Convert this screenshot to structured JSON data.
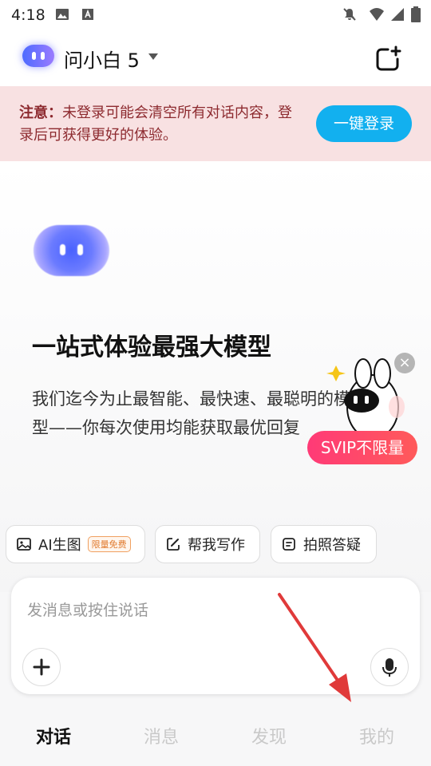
{
  "status_bar": {
    "time": "4:18"
  },
  "header": {
    "title": "问小白 5"
  },
  "notice": {
    "prefix": "注意：",
    "text": "未登录可能会清空所有对话内容，登录后可获得更好的体验。",
    "login_button": "一键登录"
  },
  "hero": {
    "headline": "一站式体验最强大模型",
    "description": "我们迄今为止最智能、最快速、最聪明的模型——你每次使用均能获取最优回复"
  },
  "promo": {
    "badge": "SVIP不限量"
  },
  "chips": [
    {
      "label": "AI生图",
      "tag": "限量免费"
    },
    {
      "label": "帮我写作"
    },
    {
      "label": "拍照答疑"
    }
  ],
  "input": {
    "placeholder": "发消息或按住说话"
  },
  "tabs": [
    {
      "label": "对话",
      "active": true
    },
    {
      "label": "消息",
      "active": false
    },
    {
      "label": "发现",
      "active": false
    },
    {
      "label": "我的",
      "active": false
    }
  ],
  "colors": {
    "accent": "#12b0ef",
    "notice_bg": "#f8e1e2",
    "notice_text": "#8d2a2f",
    "annotation_arrow": "#e03a3a"
  }
}
